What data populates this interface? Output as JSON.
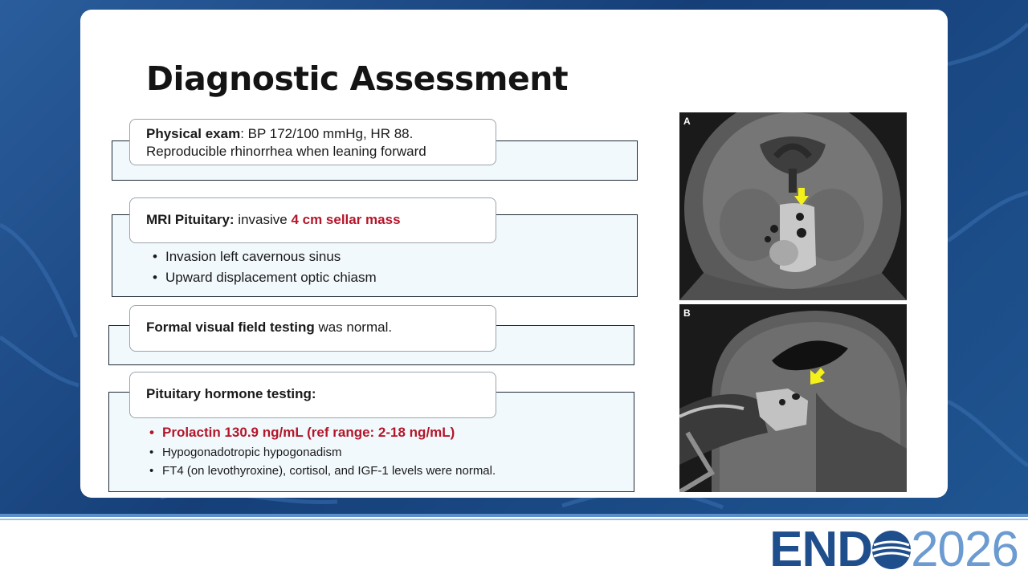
{
  "slide": {
    "title": "Diagnostic Assessment",
    "physical": {
      "label": "Physical exam",
      "text1": ": BP 172/100 mmHg, HR 88.",
      "text2": "Reproducible rhinorrhea when leaning forward"
    },
    "mri": {
      "label": "MRI Pituitary:",
      "text": " invasive ",
      "highlight": "4 cm sellar mass",
      "bullets": [
        "Invasion left cavernous sinus",
        "Upward displacement optic chiasm"
      ]
    },
    "visual": {
      "label": "Formal visual field testing",
      "text": " was normal."
    },
    "hormone": {
      "label": "Pituitary hormone testing:",
      "highlight_bullet": "Prolactin 130.9 ng/mL (ref range: 2-18 ng/mL)",
      "bullets": [
        "Hypogonadotropic hypogonadism",
        "FT4 (on levothyroxine), cortisol, and IGF-1 levels were normal."
      ]
    },
    "images": [
      {
        "label": "A",
        "view": "coronal"
      },
      {
        "label": "B",
        "view": "sagittal"
      }
    ]
  },
  "logo": {
    "part1": "END",
    "part2": "2026"
  },
  "colors": {
    "highlight_red": "#b4162a",
    "brand_blue": "#1f4e8c",
    "brand_light_blue": "#6b9bd0",
    "arrow_yellow": "#f3f01a"
  }
}
